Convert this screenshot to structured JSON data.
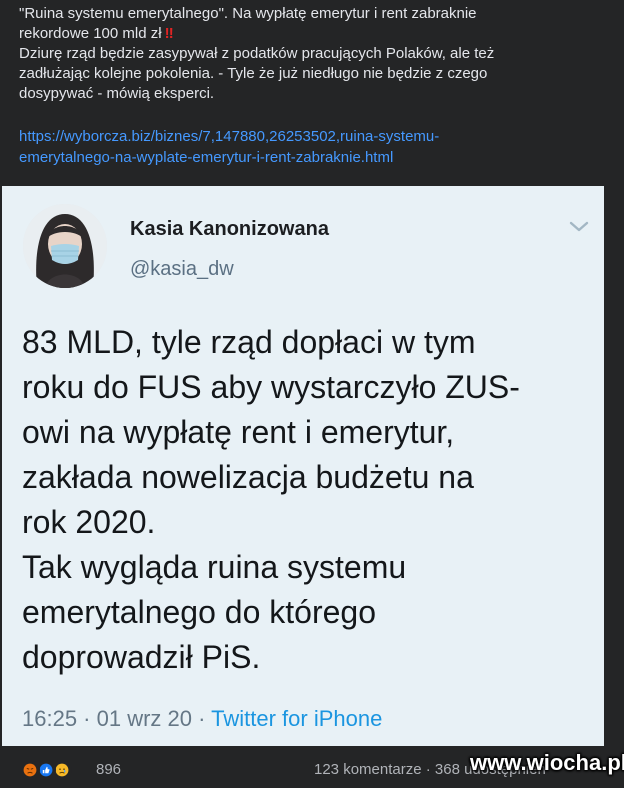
{
  "post": {
    "lines": [
      "\"Ruina systemu emerytalnego\". Na wypłatę emerytur i rent zabraknie",
      "rekordowe 100 mld zł",
      "Dziurę rząd będzie zasypywał z podatków pracujących Polaków, ale też",
      "zadłużając kolejne pokolenia. - Tyle że już niedługo nie będzie z czego",
      "dosypywać - mówią eksperci."
    ],
    "emoji": "‼",
    "link_lines": [
      "https://wyborcza.biz/biznes/7,147880,26253502,ruina-systemu-",
      "emerytalnego-na-wyplate-emerytur-i-rent-zabraknie.html"
    ]
  },
  "tweet": {
    "author_name": "Kasia Kanonizowana",
    "handle": "@kasia_dw",
    "body_lines": [
      "83 MLD, tyle rząd dopłaci w tym",
      "roku do FUS aby wystarczyło ZUS-",
      "owi na wypłatę rent i emerytur,",
      "zakłada nowelizacja budżetu na",
      "rok 2020.",
      "Tak wygląda ruina systemu",
      "emerytalnego do którego",
      "doprowadził PiS."
    ],
    "meta": "16:25 · 01 wrz 20 · ",
    "source": "Twitter for iPhone"
  },
  "footer": {
    "reaction_count": "896",
    "comments": "123 komentarze · 368 udostępnień"
  },
  "colors": {
    "background": "#242526",
    "link": "#4599ff",
    "tweet_card": "#e8f1f6",
    "twitter_blue": "#1b95e0"
  },
  "icons": [
    "chevron-down-icon",
    "angry-reaction-icon",
    "like-reaction-icon",
    "sad-reaction-icon"
  ],
  "watermark": "www.wiocha.pl"
}
